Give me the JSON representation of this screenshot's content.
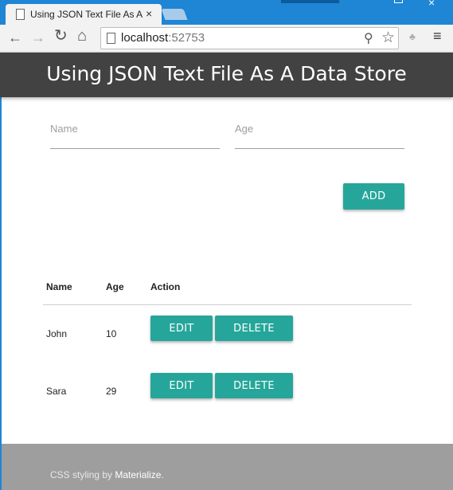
{
  "browser": {
    "tab_title": "Using JSON Text File As A Data Store",
    "tab_close": "×",
    "window_close": "×",
    "url_host": "localhost",
    "url_port": ":52753",
    "icons": {
      "back": "←",
      "forward": "→",
      "reload": "↻",
      "home": "⌂",
      "zoom": "⚲",
      "star": "☆",
      "extension": "♣",
      "menu": "≡"
    }
  },
  "header": {
    "title": "Using JSON Text File As A Data Store",
    "background": "#424242"
  },
  "form": {
    "name_placeholder": "Name",
    "age_placeholder": "Age",
    "add_label": "ADD"
  },
  "table": {
    "columns": [
      "Name",
      "Age",
      "Action"
    ],
    "rows": [
      {
        "name": "John",
        "age": "10",
        "edit_label": "EDIT",
        "delete_label": "DELETE"
      },
      {
        "name": "Sara",
        "age": "29",
        "edit_label": "EDIT",
        "delete_label": "DELETE"
      }
    ]
  },
  "footer": {
    "prefix": "CSS styling by ",
    "link": "Materialize",
    "suffix": "."
  },
  "colors": {
    "accent": "#26a69a",
    "footer": "#9e9e9e",
    "chrome": "#1e86d4"
  }
}
